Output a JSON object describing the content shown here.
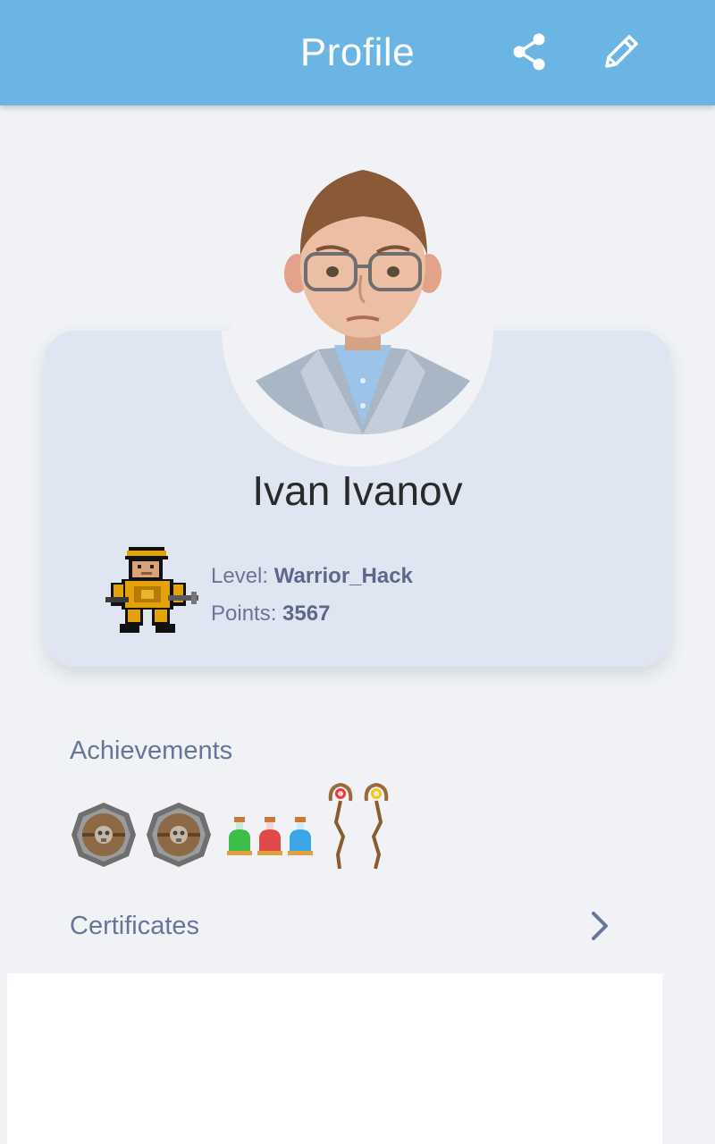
{
  "app_bar": {
    "title": "Profile",
    "share_icon": "share-icon",
    "edit_icon": "pencil-icon",
    "background": "#6ab5e3"
  },
  "profile": {
    "name": "Ivan Ivanov",
    "avatar": "child-photo-avatar",
    "level_label": "Level: ",
    "level_value": "Warrior_Hack",
    "points_label": "Points: ",
    "points_value": "3567",
    "level_sprite": "pixel-warrior-icon"
  },
  "achievements": {
    "title": "Achievements",
    "badges": [
      "shield-skull-icon",
      "shield-skull-icon",
      "potion-green-icon",
      "potion-red-icon",
      "potion-blue-icon",
      "staff-red-icon",
      "staff-yellow-icon"
    ]
  },
  "certificates": {
    "title": "Certificates",
    "chevron_icon": "chevron-right-icon"
  }
}
